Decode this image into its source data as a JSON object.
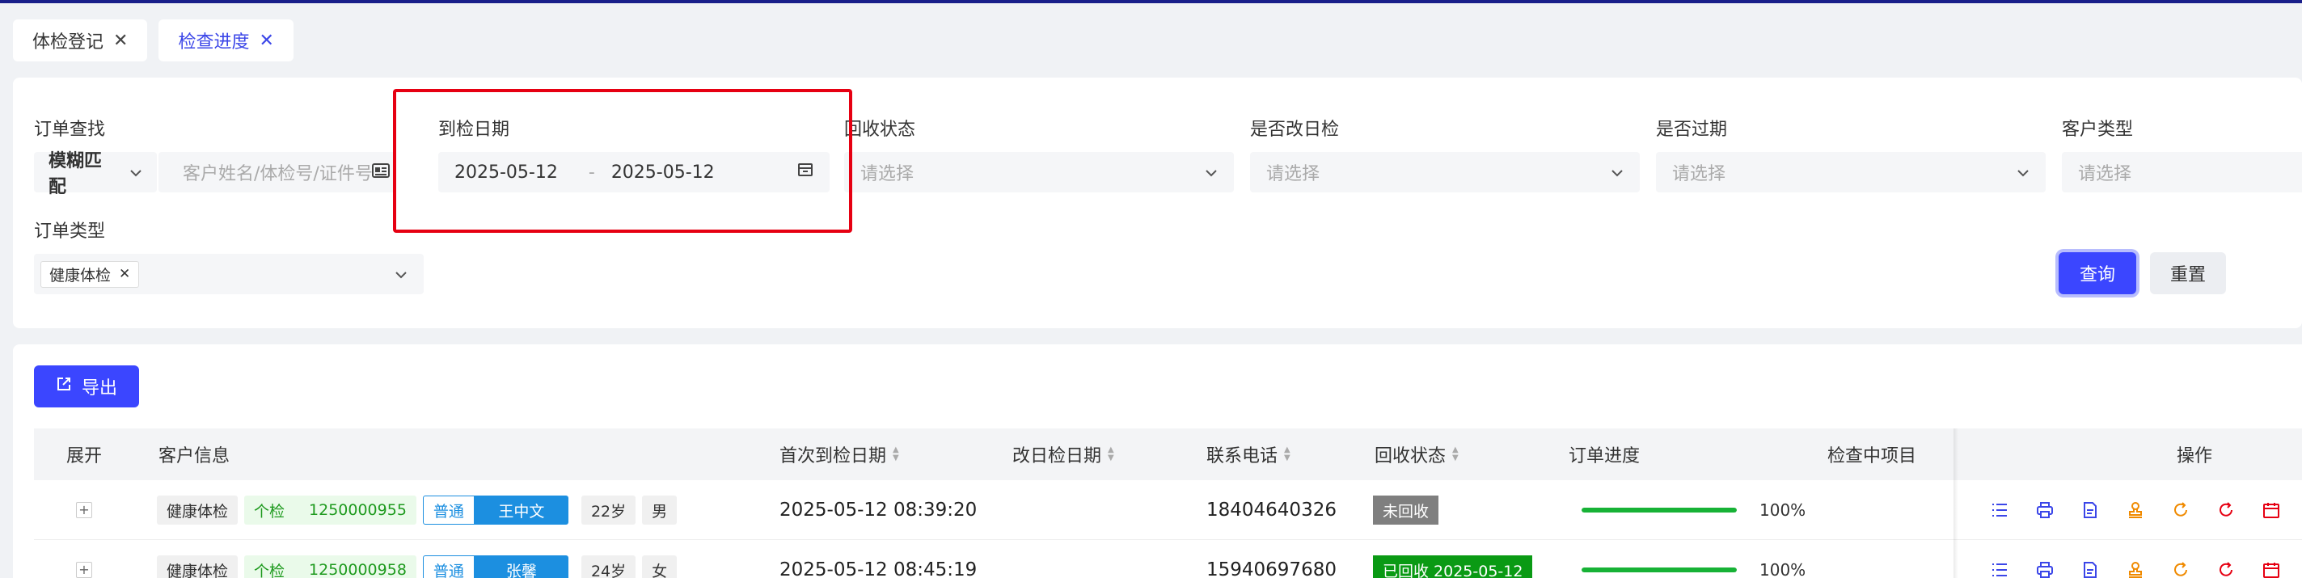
{
  "tabs": [
    {
      "label": "体检登记",
      "close": "✕"
    },
    {
      "label": "检查进度",
      "close": "✕"
    }
  ],
  "filters": {
    "order_search": {
      "label": "订单查找",
      "mode": "模糊匹配",
      "placeholder": "客户姓名/体检号/证件号"
    },
    "check_date": {
      "label": "到检日期",
      "start": "2025-05-12",
      "separator": "-",
      "end": "2025-05-12"
    },
    "recovery_status": {
      "label": "回收状态",
      "placeholder": "请选择"
    },
    "rescheduled": {
      "label": "是否改日检",
      "placeholder": "请选择"
    },
    "expired": {
      "label": "是否过期",
      "placeholder": "请选择"
    },
    "customer_type": {
      "label": "客户类型",
      "placeholder": "请选择"
    },
    "order_type": {
      "label": "订单类型",
      "tag": "健康体检",
      "tag_close": "✕"
    },
    "query_label": "查询",
    "reset_label": "重置"
  },
  "toolbar": {
    "export_label": "导出"
  },
  "table": {
    "columns": {
      "expand": "展开",
      "customer": "客户信息",
      "first_date": "首次到检日期",
      "reschedule_date": "改日检日期",
      "phone": "联系电话",
      "status": "回收状态",
      "progress": "订单进度",
      "checking": "检查中项目",
      "ops": "操作"
    },
    "rows": [
      {
        "type": "健康体检",
        "mode": "个检",
        "exam_no": "1250000955",
        "level": "普通",
        "name": "王中文",
        "age": "22岁",
        "gender": "男",
        "first_date": "2025-05-12 08:39:20",
        "phone": "18404640326",
        "status": "未回收",
        "status_kind": "gray",
        "progress": 100,
        "progress_text": "100%"
      },
      {
        "type": "健康体检",
        "mode": "个检",
        "exam_no": "1250000958",
        "level": "普通",
        "name": "张馨",
        "age": "24岁",
        "gender": "女",
        "first_date": "2025-05-12 08:45:19",
        "phone": "15940697680",
        "status": "已回收 2025-05-12",
        "status_kind": "green",
        "progress": 100,
        "progress_text": "100%"
      }
    ]
  },
  "icons": {
    "ops": [
      "list-icon",
      "print-icon",
      "document-icon",
      "stamp-icon",
      "refresh-icon",
      "redo-icon",
      "calendar-icon",
      "link-icon"
    ],
    "colors": {
      "blue": "#3b46e8",
      "orange": "#f08a00",
      "red": "#e60012"
    }
  }
}
